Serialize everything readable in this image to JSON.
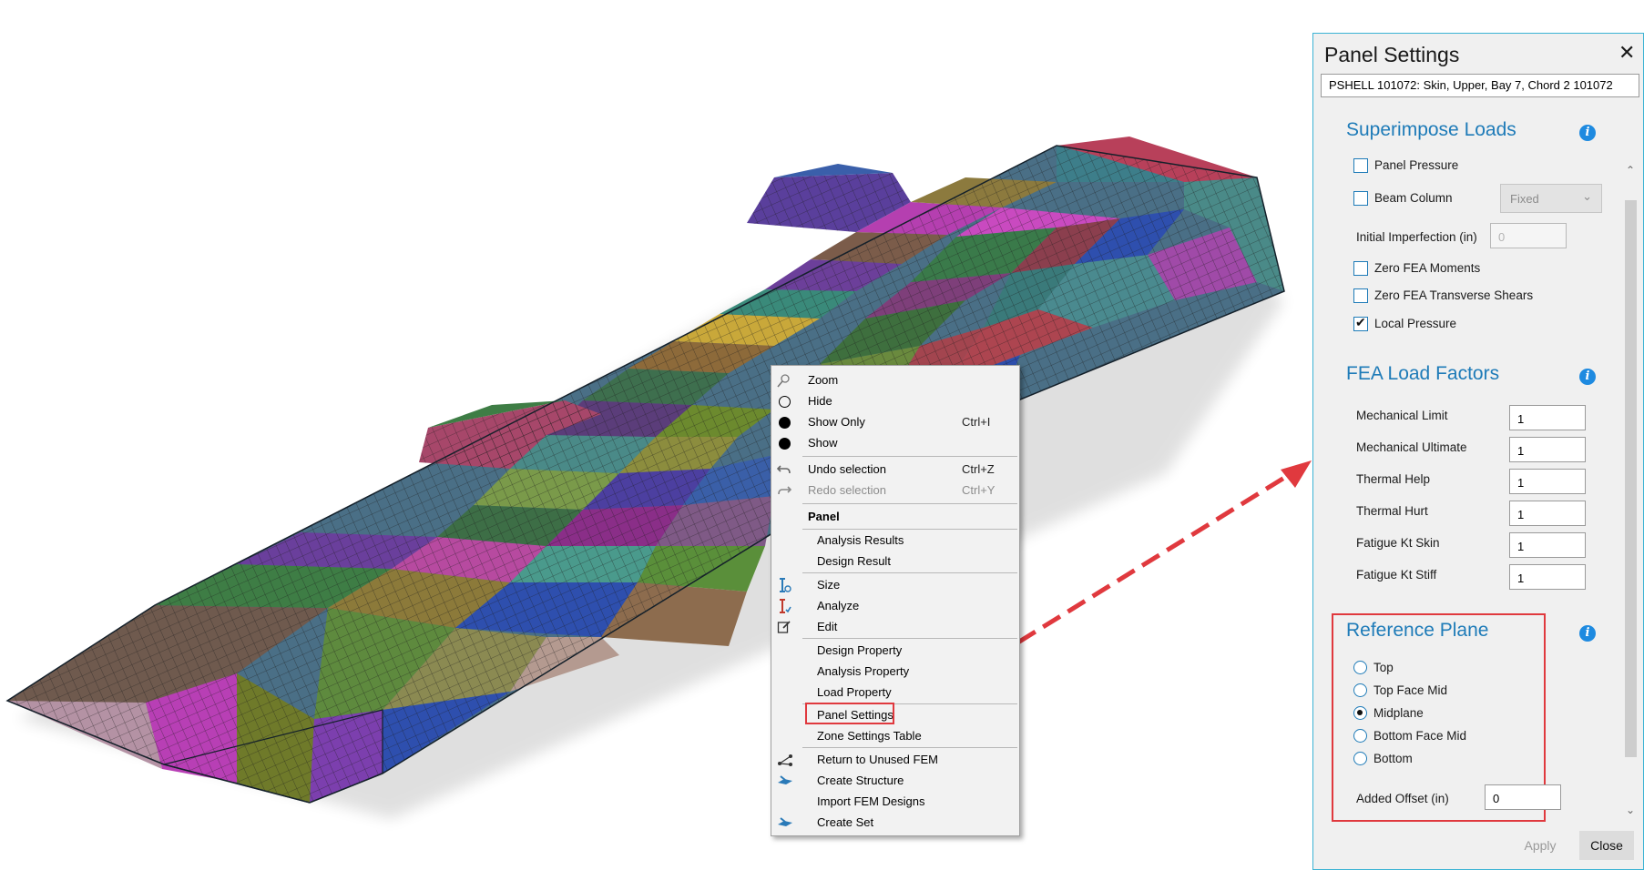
{
  "colors": {
    "accent": "#1e7bb8",
    "highlight": "#e0393e",
    "panel_border": "#3bb3d4"
  },
  "context_menu": {
    "view_items": [
      {
        "icon": "zoom-icon",
        "label": "Zoom",
        "shortcut": ""
      },
      {
        "icon": "hide-icon",
        "label": "Hide",
        "shortcut": ""
      },
      {
        "icon": "show-only-icon",
        "label": "Show Only",
        "shortcut": "Ctrl+I"
      },
      {
        "icon": "show-icon",
        "label": "Show",
        "shortcut": ""
      }
    ],
    "undo": {
      "label": "Undo selection",
      "shortcut": "Ctrl+Z"
    },
    "redo": {
      "label": "Redo selection",
      "shortcut": "Ctrl+Y"
    },
    "section_header": "Panel",
    "results": [
      "Analysis Results",
      "Design Result"
    ],
    "actions": [
      "Size",
      "Analyze",
      "Edit"
    ],
    "properties": [
      "Design Property",
      "Analysis Property",
      "Load Property"
    ],
    "settings": [
      "Panel Settings",
      "Zone Settings Table"
    ],
    "fem": [
      "Return to Unused FEM",
      "Create Structure",
      "Import FEM Designs",
      "Create Set"
    ]
  },
  "panel": {
    "title": "Panel Settings",
    "close_glyph": "✕",
    "selection": "PSHELL 101072: Skin, Upper, Bay 7, Chord 2 101072",
    "superimpose": {
      "title": "Superimpose Loads",
      "panel_pressure": "Panel Pressure",
      "beam_column": "Beam Column",
      "beam_column_option": "Fixed",
      "imperfection_label": "Initial Imperfection (in)",
      "imperfection_value": "0",
      "zero_moments": "Zero FEA Moments",
      "zero_shears": "Zero FEA Transverse Shears",
      "local_pressure": "Local Pressure"
    },
    "factors": {
      "title": "FEA Load Factors",
      "rows": [
        {
          "label": "Mechanical Limit",
          "value": "1"
        },
        {
          "label": "Mechanical Ultimate",
          "value": "1"
        },
        {
          "label": "Thermal Help",
          "value": "1"
        },
        {
          "label": "Thermal Hurt",
          "value": "1"
        },
        {
          "label": "Fatigue Kt Skin",
          "value": "1"
        },
        {
          "label": "Fatigue Kt Stiff",
          "value": "1"
        }
      ]
    },
    "reference": {
      "title": "Reference Plane",
      "options": [
        "Top",
        "Top Face Mid",
        "Midplane",
        "Bottom Face Mid",
        "Bottom"
      ],
      "selected": "Midplane",
      "offset_label": "Added Offset (in)",
      "offset_value": "0"
    },
    "apply_label": "Apply",
    "close_label": "Close"
  }
}
